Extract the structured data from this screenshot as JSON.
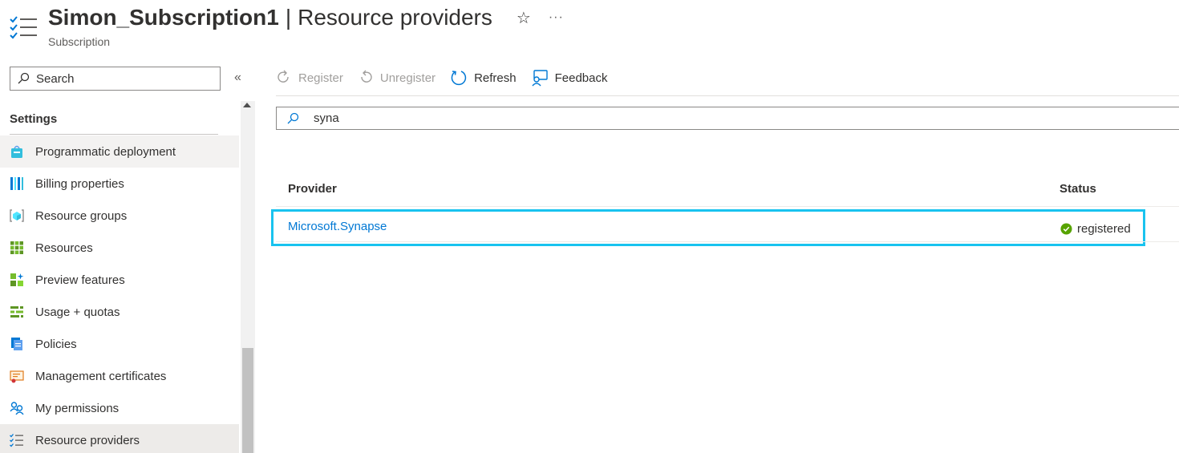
{
  "header": {
    "title": "Simon_Subscription1",
    "separator": "|",
    "page_name": "Resource providers",
    "subtitle": "Subscription",
    "favorite_icon": "star-icon",
    "more_icon": "ellipsis-icon"
  },
  "sidebar": {
    "search_placeholder": "Search",
    "collapse_label": "«",
    "section_heading": "Settings",
    "items": [
      {
        "label": "Programmatic deployment",
        "icon": "shopping-bag-icon"
      },
      {
        "label": "Billing properties",
        "icon": "billing-bars-icon"
      },
      {
        "label": "Resource groups",
        "icon": "resource-group-cube-icon"
      },
      {
        "label": "Resources",
        "icon": "resources-grid-icon"
      },
      {
        "label": "Preview features",
        "icon": "preview-features-icon"
      },
      {
        "label": "Usage + quotas",
        "icon": "usage-quotas-icon"
      },
      {
        "label": "Policies",
        "icon": "policies-icon"
      },
      {
        "label": "Management certificates",
        "icon": "certificate-icon"
      },
      {
        "label": "My permissions",
        "icon": "permissions-people-icon"
      },
      {
        "label": "Resource providers",
        "icon": "resource-providers-checklist-icon"
      }
    ]
  },
  "toolbar": {
    "register_label": "Register",
    "unregister_label": "Unregister",
    "refresh_label": "Refresh",
    "feedback_label": "Feedback"
  },
  "filter": {
    "value": "syna"
  },
  "table": {
    "columns": [
      "Provider",
      "Status"
    ],
    "rows": [
      {
        "provider": "Microsoft.Synapse",
        "status": "registered"
      }
    ]
  },
  "colors": {
    "accent": "#0078d4",
    "highlight_border": "#19c3ef",
    "status_ok": "#57a300",
    "disabled_text": "#a19f9d"
  }
}
